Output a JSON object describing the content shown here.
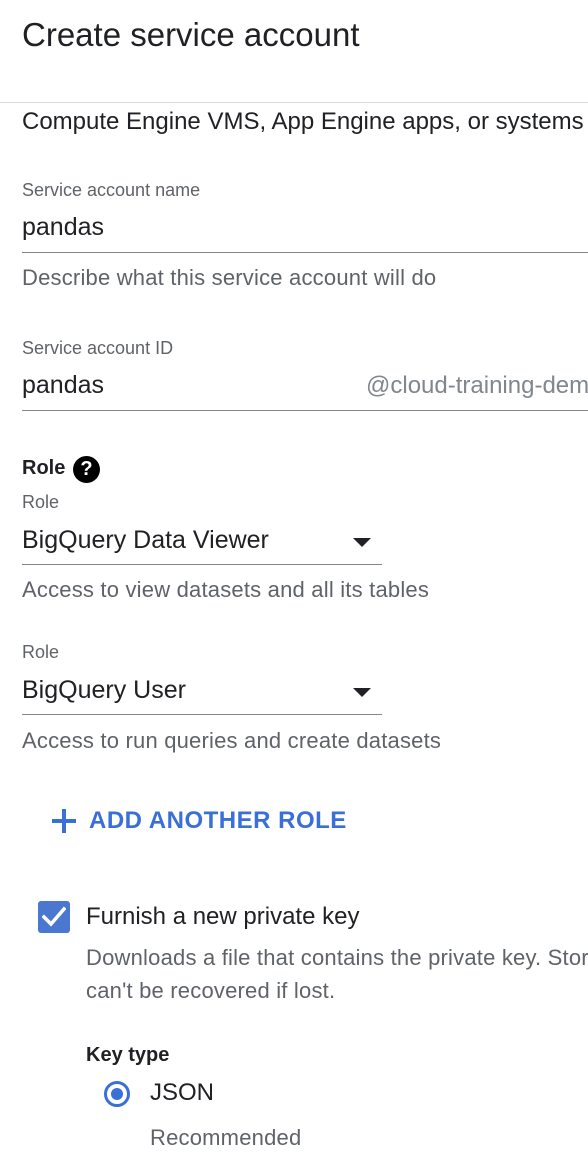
{
  "dialog": {
    "title": "Create service account",
    "intro": "Compute Engine VMS, App Engine apps, or systems"
  },
  "service_account_name": {
    "label": "Service account name",
    "value": "pandas",
    "helper": "Describe what this service account will do"
  },
  "service_account_id": {
    "label": "Service account ID",
    "value": "pandas",
    "suffix": "@cloud-training-demos.iam.gserviceaccount.com"
  },
  "role_section": {
    "title": "Role",
    "help_icon": "help-circle-icon",
    "roles": [
      {
        "label": "Role",
        "value": "BigQuery Data Viewer",
        "description": "Access to view datasets and all its tables"
      },
      {
        "label": "Role",
        "value": "BigQuery User",
        "description": "Access to run queries and create datasets"
      }
    ],
    "add_role_label": "ADD ANOTHER ROLE"
  },
  "private_key": {
    "checked": true,
    "label": "Furnish a new private key",
    "description_line1": "Downloads a file that contains the private key. Store the file securely because this key",
    "description_line2": "can't be recovered if lost."
  },
  "key_type": {
    "title": "Key type",
    "options": [
      {
        "label": "JSON",
        "selected": true,
        "note": "Recommended"
      }
    ]
  },
  "colors": {
    "accent": "#3a6fd8",
    "checkbox": "#4a78d1",
    "helper_text": "#5f6368",
    "divider": "#dadce0"
  }
}
